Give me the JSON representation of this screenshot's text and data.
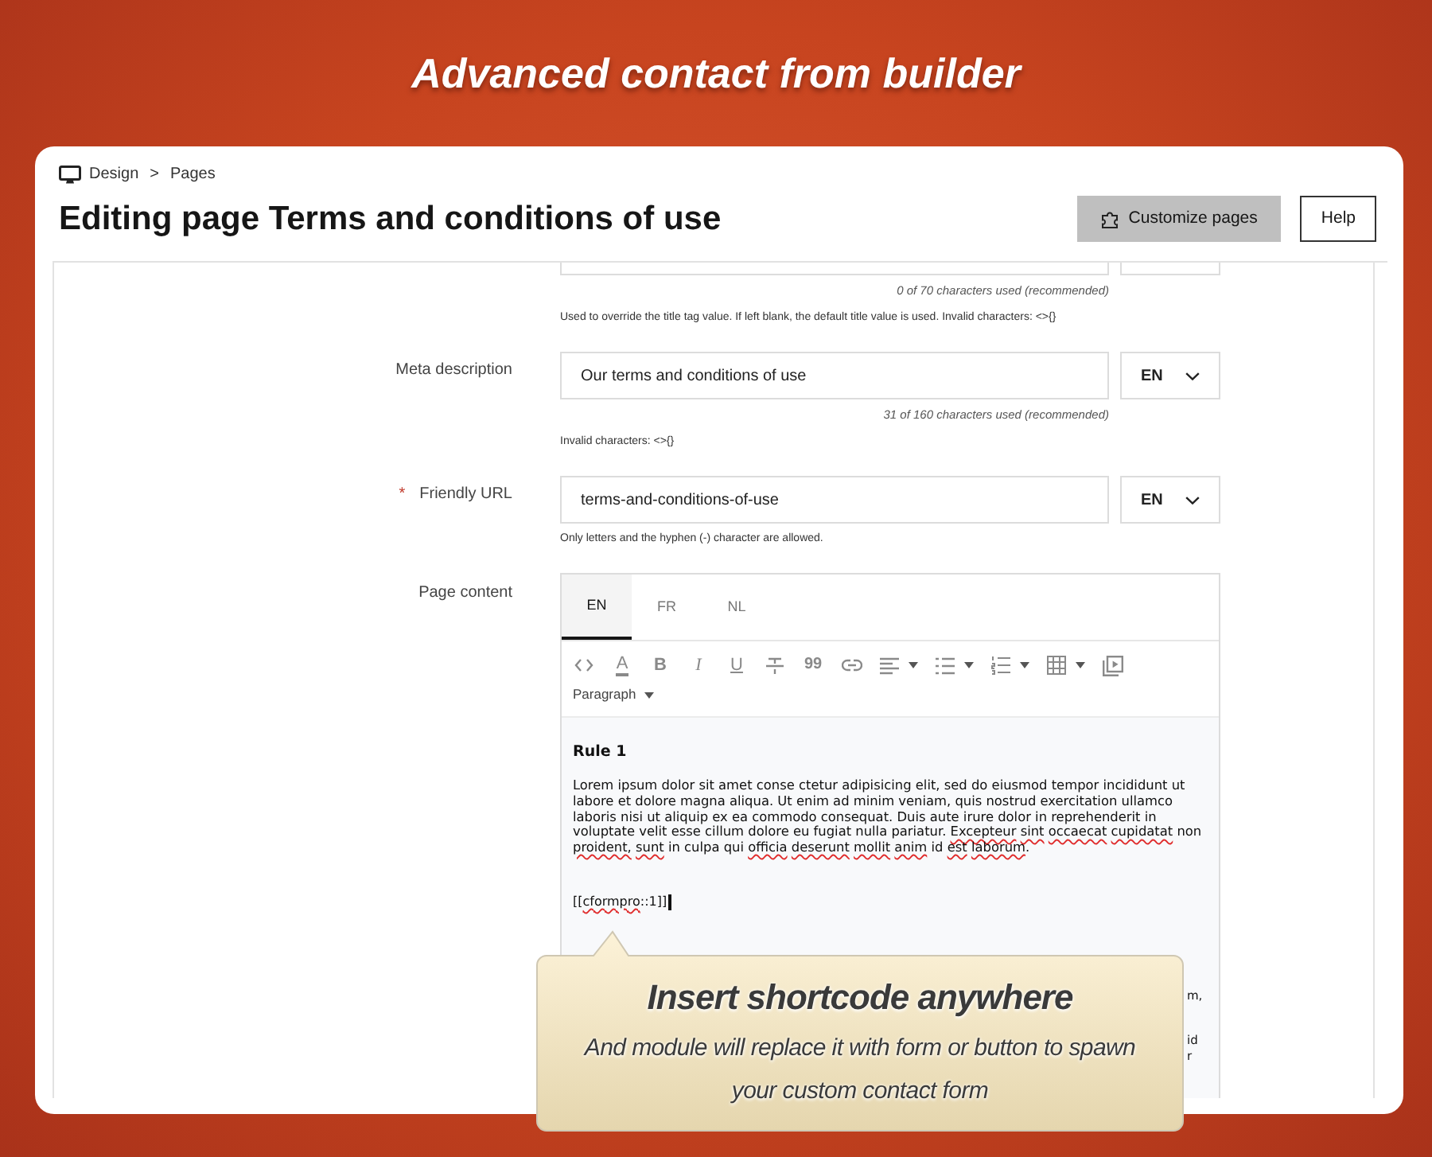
{
  "page_title": "Advanced contact from builder",
  "header": {
    "breadcrumb": [
      {
        "label": "Design"
      },
      {
        "label": "Pages"
      }
    ],
    "separator": ">",
    "title": "Editing page Terms and conditions of use",
    "buttons": [
      {
        "label": "Customize pages",
        "kind": "primary"
      },
      {
        "label": "Help",
        "kind": "outline"
      }
    ]
  },
  "form": {
    "title_field": {
      "counter": "0 of 70 characters used (recommended)",
      "hint": "Used to override the title tag value. If left blank, the default title value is used. Invalid characters: <>{}"
    },
    "fields": [
      {
        "label": "Meta description",
        "value": "Our terms and conditions of use",
        "language": "EN",
        "counter": "31 of 160 characters used (recommended)",
        "hint": "Invalid characters: <>{}"
      },
      {
        "marker": "*",
        "label": "Friendly URL",
        "value": "terms-and-conditions-of-use",
        "language": "EN",
        "hint": "Only letters and the hyphen (-) character are allowed."
      }
    ],
    "page_content": {
      "label": "Page content",
      "tabs": [
        {
          "label": "EN",
          "selected": true
        },
        {
          "label": "FR",
          "selected": false
        },
        {
          "label": "NL",
          "selected": false
        }
      ],
      "toolbar": [
        {
          "kind": "code",
          "dropdown": false
        },
        {
          "kind": "color",
          "label": "A",
          "dropdown": false
        },
        {
          "kind": "bold",
          "label": "B",
          "dropdown": false
        },
        {
          "kind": "italic",
          "label": "I",
          "dropdown": false
        },
        {
          "kind": "underline",
          "label": "U",
          "dropdown": false
        },
        {
          "kind": "strike",
          "dropdown": false
        },
        {
          "kind": "quote",
          "label": "99",
          "dropdown": false
        },
        {
          "kind": "link",
          "dropdown": false
        },
        {
          "kind": "align",
          "dropdown": true
        },
        {
          "kind": "bullets",
          "dropdown": true
        },
        {
          "kind": "numbers",
          "dropdown": true
        },
        {
          "kind": "table",
          "dropdown": true
        },
        {
          "kind": "media",
          "dropdown": false
        }
      ],
      "format": "Paragraph",
      "content": {
        "heading": "Rule 1",
        "paragraph": [
          {
            "text": "Lorem ipsum dolor sit amet conse ctetur adipisicing elit, sed do eiusmod tempor incididunt ut labore et dolore magna aliqua. Ut enim ad minim veniam, quis nostrud exercitation ullamco laboris nisi ut aliquip ex ea commodo consequat. Duis aute irure dolor in reprehenderit in voluptate velit esse cillum dolore eu fugiat nulla pariatur. ",
            "misspelled": false
          },
          {
            "text": "Excepteur sint occaecat cupidatat",
            "misspelled": true
          },
          {
            "text": " non ",
            "misspelled": false
          },
          {
            "text": "proident, sunt",
            "misspelled": true
          },
          {
            "text": " in culpa qui ",
            "misspelled": false
          },
          {
            "text": "officia deserunt mollit anim",
            "misspelled": true
          },
          {
            "text": " id ",
            "misspelled": false
          },
          {
            "text": "est laborum",
            "misspelled": true
          },
          {
            "text": ".",
            "misspelled": false
          }
        ],
        "shortcode": [
          {
            "text": "[[",
            "misspelled": false
          },
          {
            "text": "cformpro",
            "misspelled": true
          },
          {
            "text": "::1]]",
            "misspelled": false
          }
        ],
        "cursor": true,
        "covered_text": [
          "m,",
          "id",
          "r"
        ]
      }
    }
  },
  "callout": {
    "title": "Insert shortcode anywhere",
    "text": "And module will replace it with form or button to spawn your custom contact form"
  }
}
